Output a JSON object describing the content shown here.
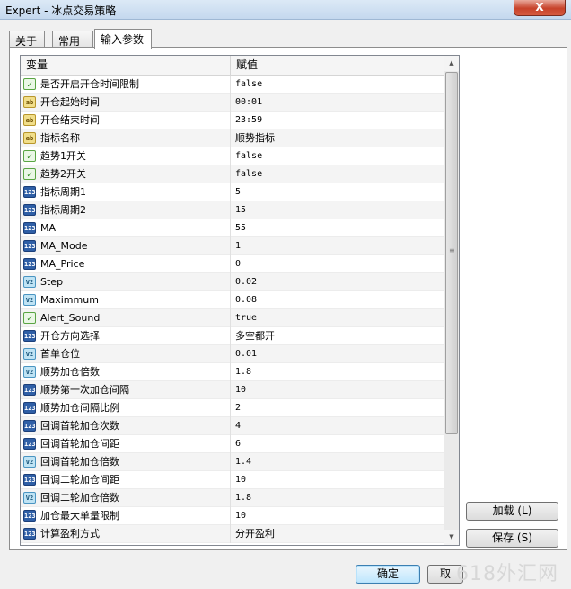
{
  "window": {
    "title": "Expert - 冰点交易策略",
    "close_label": "X"
  },
  "tabs": [
    {
      "label": "关于"
    },
    {
      "label": "常用"
    },
    {
      "label": "输入参数",
      "active": true
    }
  ],
  "grid": {
    "header": {
      "variable": "变量",
      "value": "赋值"
    },
    "rows": [
      {
        "icon": "bool-icon",
        "name": "是否开启开仓时间限制",
        "value": "false"
      },
      {
        "icon": "string-icon",
        "name": "开仓起始时间",
        "value": "00:01"
      },
      {
        "icon": "string-icon",
        "name": "开仓结束时间",
        "value": "23:59"
      },
      {
        "icon": "string-icon",
        "name": "指标名称",
        "value": "顺势指标"
      },
      {
        "icon": "bool-icon",
        "name": "趋势1开关",
        "value": "false"
      },
      {
        "icon": "bool-icon",
        "name": "趋势2开关",
        "value": "false"
      },
      {
        "icon": "int-icon",
        "name": "指标周期1",
        "value": "5"
      },
      {
        "icon": "int-icon",
        "name": "指标周期2",
        "value": "15"
      },
      {
        "icon": "int-icon",
        "name": "MA",
        "value": "55"
      },
      {
        "icon": "int-icon",
        "name": "MA_Mode",
        "value": "1"
      },
      {
        "icon": "int-icon",
        "name": "MA_Price",
        "value": "0"
      },
      {
        "icon": "double-icon",
        "name": "Step",
        "value": "0.02"
      },
      {
        "icon": "double-icon",
        "name": "Maximmum",
        "value": "0.08"
      },
      {
        "icon": "bool-icon",
        "name": "Alert_Sound",
        "value": "true"
      },
      {
        "icon": "int-icon",
        "name": "开仓方向选择",
        "value": "多空都开"
      },
      {
        "icon": "double-icon",
        "name": "首单仓位",
        "value": "0.01"
      },
      {
        "icon": "double-icon",
        "name": "顺势加仓倍数",
        "value": "1.8"
      },
      {
        "icon": "int-icon",
        "name": "顺势第一次加仓间隔",
        "value": "10"
      },
      {
        "icon": "int-icon",
        "name": "顺势加仓间隔比例",
        "value": "2"
      },
      {
        "icon": "int-icon",
        "name": "回调首轮加仓次数",
        "value": "4"
      },
      {
        "icon": "int-icon",
        "name": "回调首轮加仓间距",
        "value": "6"
      },
      {
        "icon": "double-icon",
        "name": "回调首轮加仓倍数",
        "value": "1.4"
      },
      {
        "icon": "int-icon",
        "name": "回调二轮加仓间距",
        "value": "10"
      },
      {
        "icon": "double-icon",
        "name": "回调二轮加仓倍数",
        "value": "1.8"
      },
      {
        "icon": "int-icon",
        "name": "加仓最大单量限制",
        "value": "10"
      },
      {
        "icon": "int-icon",
        "name": "计算盈利方式",
        "value": "分开盈利"
      }
    ]
  },
  "icon_labels": {
    "bool-icon": "✓",
    "string-icon": "ab",
    "int-icon": "123",
    "double-icon": "V2"
  },
  "buttons": {
    "load": "加载 (L)",
    "save": "保存 (S)",
    "ok": "确定",
    "cancel": "取"
  },
  "watermark": "618外汇网"
}
